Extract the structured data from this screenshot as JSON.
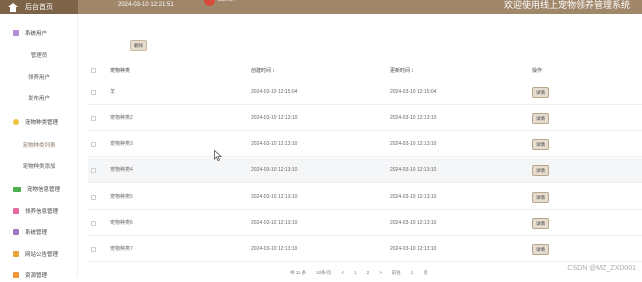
{
  "header": {
    "home_label": "后台首页",
    "datetime": "2024-03-10 12:21:51",
    "user_name": "admin",
    "site_title": "欢迎使用线上宠物领养管理系统"
  },
  "sidebar": {
    "items": [
      {
        "label": "系统用户",
        "icon": "user-icon",
        "color": "#b38bd6"
      },
      {
        "label": "管理员"
      },
      {
        "label": "领养用户"
      },
      {
        "label": "发布用户"
      },
      {
        "label": "宠物种类管理",
        "icon": "tag-icon",
        "color": "#f2c23a"
      },
      {
        "label": "宠物种类列表"
      },
      {
        "label": "宠物种类添加"
      },
      {
        "label": "宠物信息管理",
        "icon": "pet-icon",
        "color": "#4caf50"
      },
      {
        "label": "领养信息管理",
        "icon": "form-icon",
        "color": "#e66aa3"
      },
      {
        "label": "系统管理",
        "icon": "system-icon",
        "color": "#a378c8"
      },
      {
        "label": "网站公告管理",
        "icon": "notice-icon",
        "color": "#e8a43a"
      },
      {
        "label": "资源管理",
        "icon": "resource-icon",
        "color": "#f29a3a"
      }
    ]
  },
  "toolbar": {
    "delete_label": "删除"
  },
  "table": {
    "columns": [
      "宠物种类",
      "创建时间 ↕",
      "更新时间 ↕",
      "操作"
    ],
    "detail_label": "详情",
    "rows": [
      {
        "name": "羊",
        "created": "2024-03-10 12:15:04",
        "updated": "2024-03-10 12:15:04"
      },
      {
        "name": "宠物种类2",
        "created": "2024-03-10 12:13:10",
        "updated": "2024-03-10 12:13:10"
      },
      {
        "name": "宠物种类3",
        "created": "2024-03-10 12:13:10",
        "updated": "2024-03-10 12:13:10"
      },
      {
        "name": "宠物种类4",
        "created": "2024-03-10 12:13:10",
        "updated": "2024-03-10 12:13:10"
      },
      {
        "name": "宠物种类5",
        "created": "2024-03-10 12:13:10",
        "updated": "2024-03-10 12:13:10"
      },
      {
        "name": "宠物种类6",
        "created": "2024-03-10 12:13:10",
        "updated": "2024-03-10 12:13:10"
      },
      {
        "name": "宠物种类7",
        "created": "2024-03-10 12:13:10",
        "updated": "2024-03-10 12:13:10"
      }
    ]
  },
  "pager": {
    "total": "共 11 条",
    "page_size": "10条/页",
    "prev": "<",
    "page1": "1",
    "page2": "2",
    "next": ">",
    "goto": "前往",
    "goto_page": "1",
    "page_unit": "页"
  },
  "watermark": "CSDN @MZ_ZXD001"
}
